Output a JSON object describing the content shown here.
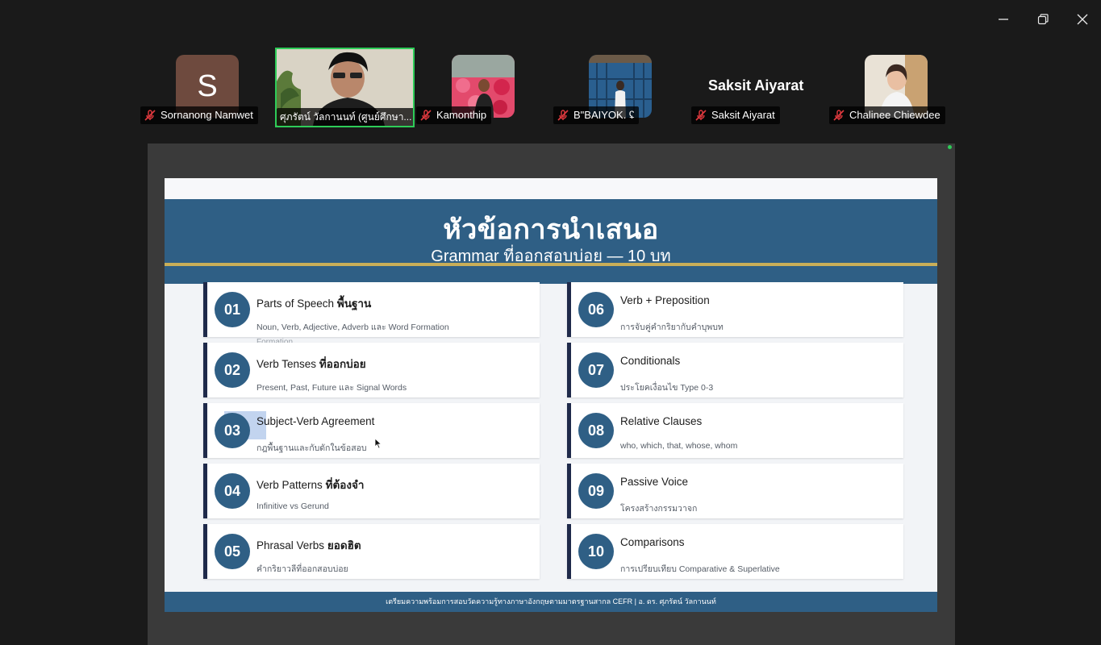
{
  "window": {
    "controls": {
      "minimize": "minimize-icon",
      "restore": "restore-icon",
      "close": "close-icon"
    }
  },
  "participants": [
    {
      "name": "Sornanong Namwet",
      "avatar_letter": "S",
      "muted": true
    },
    {
      "name": "ศุภรัตน์ วัลกานนท์ (ศูนย์ศึกษา...",
      "muted": false,
      "active_speaker": true
    },
    {
      "name": "Kamonthip",
      "muted": true
    },
    {
      "name": "B\"BAIYOK. ʢ",
      "muted": true
    },
    {
      "name": "Saksit Aiyarat",
      "display_name": "Saksit Aiyarat",
      "muted": true
    },
    {
      "name": "Chalinee Chiewdee",
      "muted": true
    }
  ],
  "slide": {
    "title": "หัวข้อการนำเสนอ",
    "subtitle": "Grammar ที่ออกสอบบ่อย — 10 บท",
    "topics": [
      {
        "num": "01",
        "title_en": "Parts of Speech",
        "title_th": "พื้นฐาน",
        "desc": "Noun, Verb, Adjective, Adverb และ Word Formation",
        "overflow": "Formation"
      },
      {
        "num": "02",
        "title_en": "Verb Tenses",
        "title_th": "ที่ออกบ่อย",
        "desc": "Present, Past, Future และ Signal Words"
      },
      {
        "num": "03",
        "title_en": "Subject-Verb Agreement",
        "title_th": "",
        "desc": "กฎพื้นฐานและกับดักในข้อสอบ"
      },
      {
        "num": "04",
        "title_en": "Verb Patterns",
        "title_th": "ที่ต้องจำ",
        "desc": "Infinitive vs Gerund"
      },
      {
        "num": "05",
        "title_en": "Phrasal Verbs",
        "title_th": "ยอดฮิต",
        "desc": "คำกริยาวลีที่ออกสอบบ่อย"
      },
      {
        "num": "06",
        "title_en": "Verb + Preposition",
        "title_th": "",
        "desc": "การจับคู่คำกริยากับคำบุพบท"
      },
      {
        "num": "07",
        "title_en": "Conditionals",
        "title_th": "",
        "desc": "ประโยคเงื่อนไข Type 0-3"
      },
      {
        "num": "08",
        "title_en": "Relative Clauses",
        "title_th": "",
        "desc": "who, which, that, whose, whom"
      },
      {
        "num": "09",
        "title_en": "Passive Voice",
        "title_th": "",
        "desc": "โครงสร้างกรรมวาจก"
      },
      {
        "num": "10",
        "title_en": "Comparisons",
        "title_th": "",
        "desc": "การเปรียบเทียบ Comparative & Superlative"
      }
    ],
    "footer": "เตรียมความพร้อมการสอบวัดความรู้ทางภาษาอังกฤษตามมาตรฐานสากล CEFR | อ. ดร. ศุภรัตน์ วัลกานนท์"
  },
  "colors": {
    "accent_blue": "#2f5f85",
    "gold": "#c9ae58",
    "active_border": "#2ecc58",
    "muted_red": "#e0393e"
  }
}
